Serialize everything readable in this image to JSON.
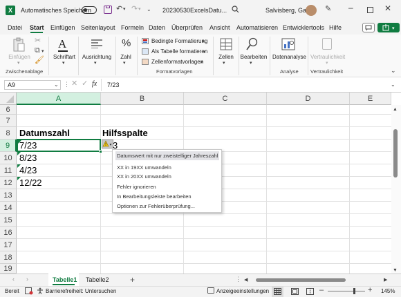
{
  "titlebar": {
    "autosave_label": "Automatisches Speichern",
    "autosave_state": "off",
    "filename": "20230530ExcelsDatu...",
    "user_name": "Salvisberg, Gaby",
    "icons": [
      "excel-logo-icon",
      "save-icon",
      "undo-icon",
      "redo-icon",
      "search-icon",
      "pen-icon",
      "minimize-icon",
      "maximize-icon",
      "close-icon"
    ]
  },
  "menu": {
    "tabs": [
      "Datei",
      "Start",
      "Einfügen",
      "Seitenlayout",
      "Formeln",
      "Daten",
      "Überprüfen",
      "Ansicht",
      "Automatisieren",
      "Entwicklertools",
      "Hilfe"
    ],
    "active_tab": "Start",
    "accent": "#107c41"
  },
  "ribbon": {
    "einfuegen": "Einfügen",
    "zwischenablage": "Zwischenablage",
    "schriftart": "Schriftart",
    "ausrichtung": "Ausrichtung",
    "zahl": "Zahl",
    "bedingte": "Bedingte Formatierung",
    "als_tabelle": "Als Tabelle formatieren",
    "zellformat": "Zellenformatvorlagen",
    "formatvorlagen": "Formatvorlagen",
    "zellen": "Zellen",
    "bearbeiten": "Bearbeiten",
    "datenanalyse": "Datenanalyse",
    "analyse": "Analyse",
    "vertraulichkeit_btn": "Vertraulichkeit",
    "vertraulichkeit": "Vertraulichkeit"
  },
  "formula_bar": {
    "name_box": "A9",
    "fx": "fx",
    "content": "7/23"
  },
  "grid": {
    "columns": [
      "A",
      "B",
      "C",
      "D",
      "E"
    ],
    "selected_column": "A",
    "rows": [
      "6",
      "7",
      "8",
      "9",
      "10",
      "11",
      "12",
      "13",
      "14",
      "15",
      "16",
      "17",
      "18",
      "19"
    ],
    "selected_row": "9",
    "cells": {
      "A8": "Datumszahl",
      "B8": "Hilfsspalte",
      "A9": "7/23",
      "A10": "8/23",
      "A11": "4/23",
      "A12": "12/22",
      "B9": "3"
    }
  },
  "error_menu": {
    "items": [
      "Datumswert mit nur zweistelliger Jahreszahl",
      "XX in 19XX umwandeln",
      "XX in 20XX umwandeln",
      "Fehler ignorieren",
      "In Bearbeitungsleiste bearbeiten",
      "Optionen zur Fehlerüberprüfung..."
    ]
  },
  "sheets": {
    "tabs": [
      "Tabelle1",
      "Tabelle2"
    ],
    "active": "Tabelle1",
    "add": "+"
  },
  "status": {
    "ready": "Bereit",
    "accessibility": "Barrierefreiheit: Untersuchen",
    "display_settings": "Anzeigeeinstellungen",
    "zoom": "145%"
  }
}
